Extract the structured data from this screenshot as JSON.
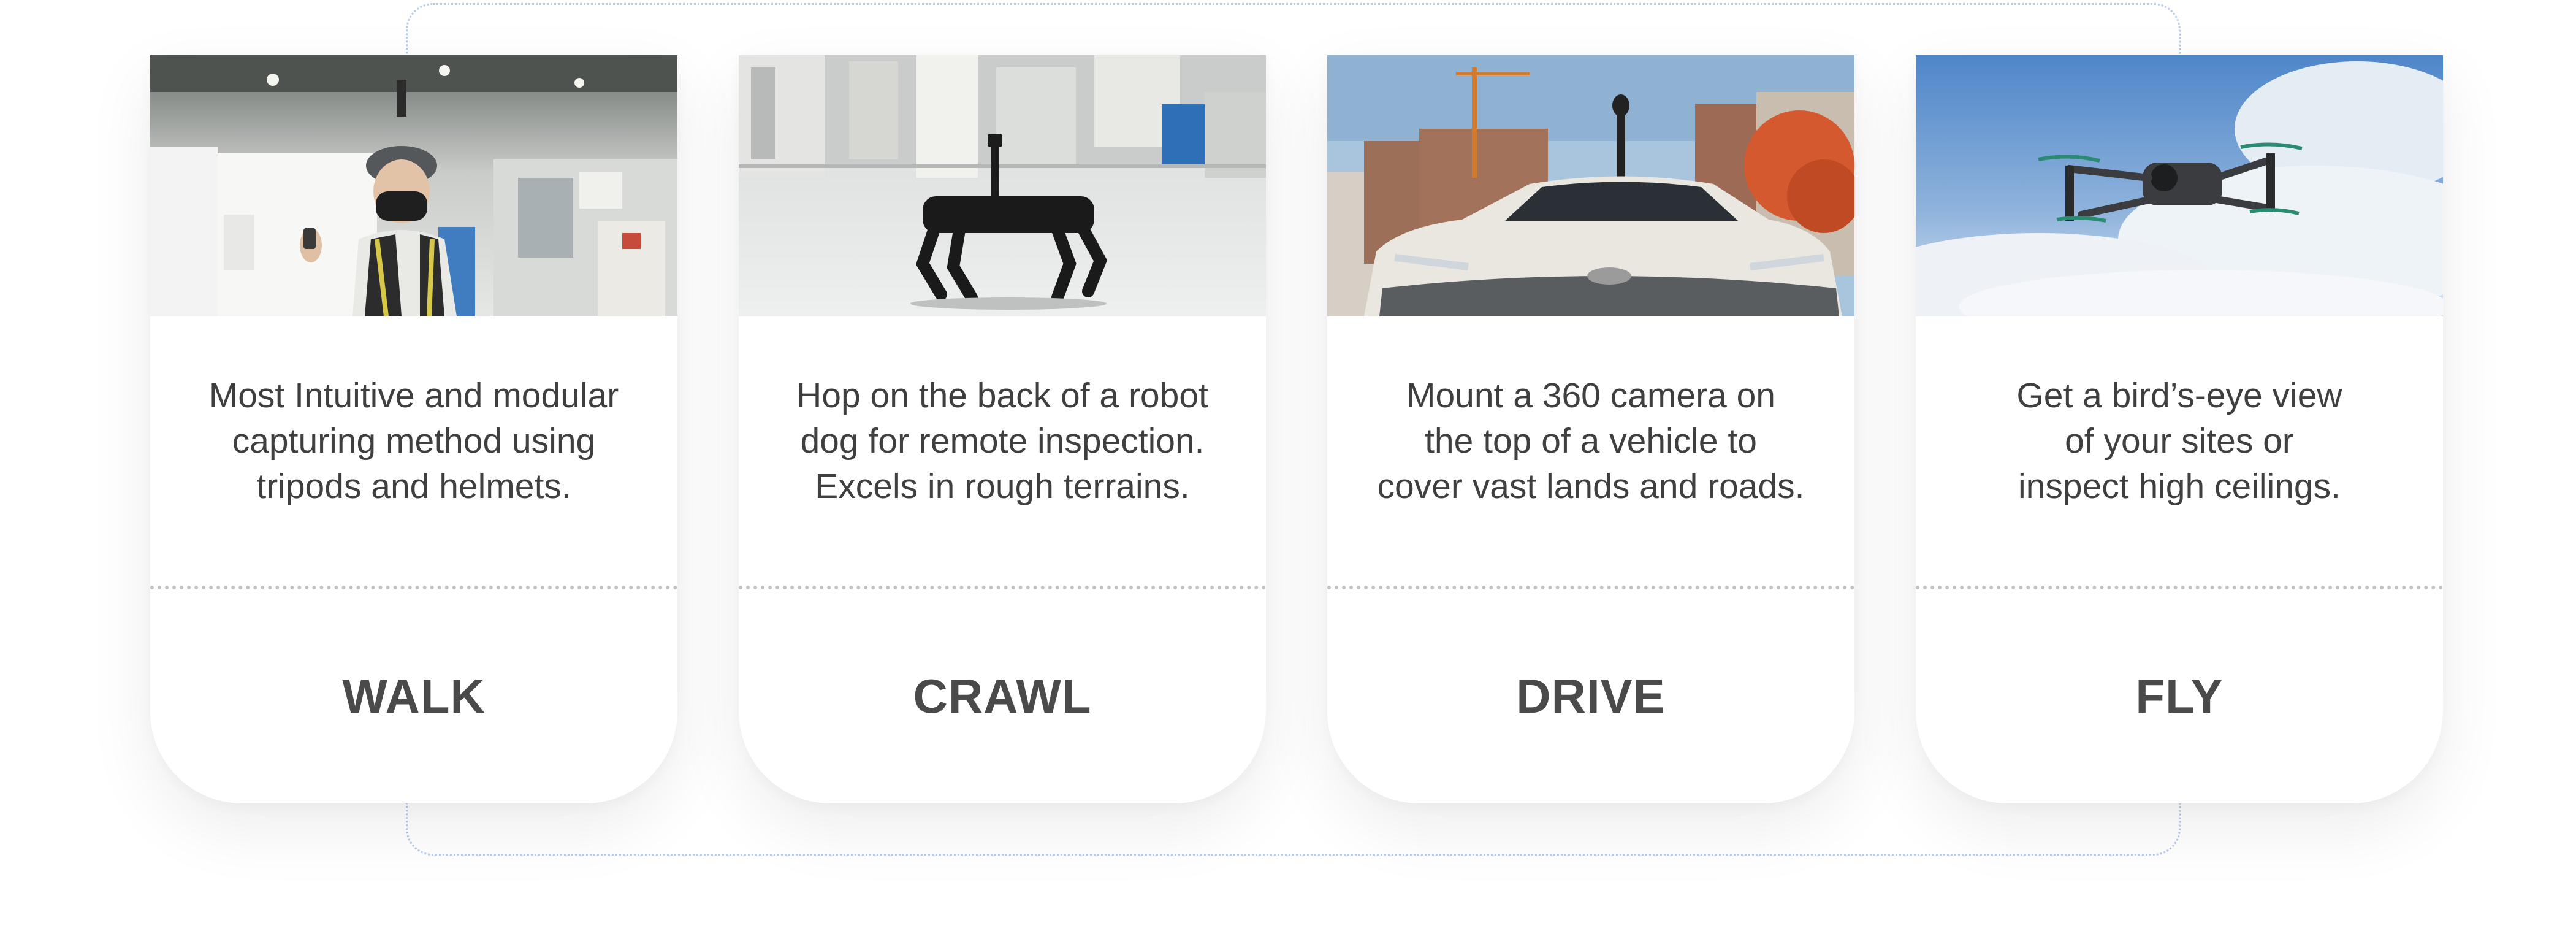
{
  "cards": [
    {
      "image_alt": "worker wearing helmet with 360 camera in factory",
      "description_lines": [
        "Most Intuitive and modular",
        "capturing method using",
        "tripods and helmets."
      ],
      "mode": "WALK"
    },
    {
      "image_alt": "robot dog with camera in factory",
      "description_lines": [
        "Hop on the back of a robot",
        "dog for remote inspection.",
        "Excels in rough terrains."
      ],
      "mode": "CRAWL"
    },
    {
      "image_alt": "car with 360 camera on roof at construction site",
      "description_lines": [
        "Mount a 360 camera on",
        "the top of a vehicle to",
        "cover vast lands and roads."
      ],
      "mode": "DRIVE"
    },
    {
      "image_alt": "drone flying in cloudy sky",
      "description_lines": [
        "Get a bird’s-eye view",
        "of your sites or",
        "inspect high ceilings."
      ],
      "mode": "FLY"
    }
  ],
  "colors": {
    "text": "#3f3f3f",
    "mode_text": "#4a4a4a",
    "frame_border": "#b9cbe6",
    "divider": "#c4c4c4"
  }
}
